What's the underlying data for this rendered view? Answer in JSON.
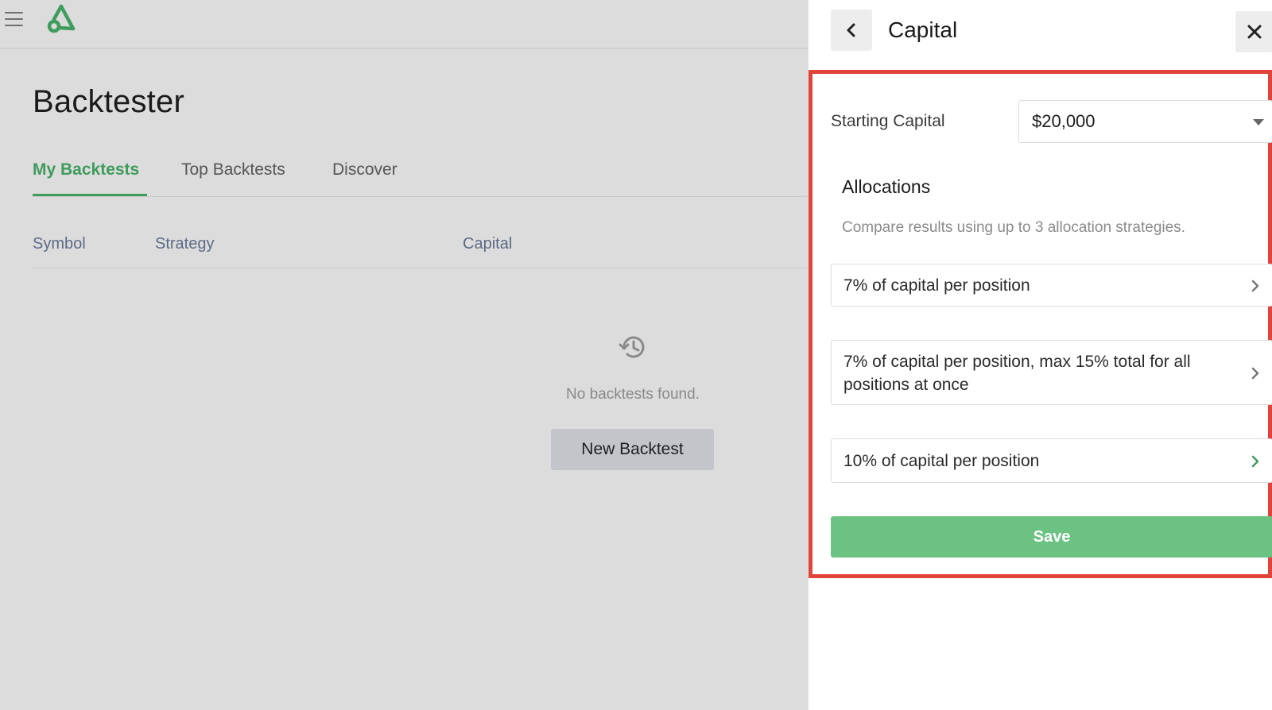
{
  "app": {
    "page_title": "Backtester",
    "tabs": [
      {
        "label": "My Backtests",
        "active": true
      },
      {
        "label": "Top Backtests",
        "active": false
      },
      {
        "label": "Discover",
        "active": false
      }
    ],
    "columns": [
      "Symbol",
      "Strategy",
      "Capital"
    ],
    "empty_state": {
      "icon": "history-icon",
      "message": "No backtests found.",
      "button_label": "New Backtest"
    },
    "brand_color": "#3f9c5d"
  },
  "panel": {
    "title": "Capital",
    "back_icon": "chevron-left-icon",
    "close_icon": "close-icon",
    "starting_capital": {
      "label": "Starting Capital",
      "value": "$20,000"
    },
    "allocations": {
      "title": "Allocations",
      "description": "Compare results using up to 3 allocation strategies.",
      "options": [
        "7% of capital per position",
        "7% of capital per position, max 15% total for all positions at once",
        "10% of capital per position"
      ]
    },
    "save_label": "Save",
    "save_color": "#6cc283",
    "highlight_color": "#e0443a"
  }
}
